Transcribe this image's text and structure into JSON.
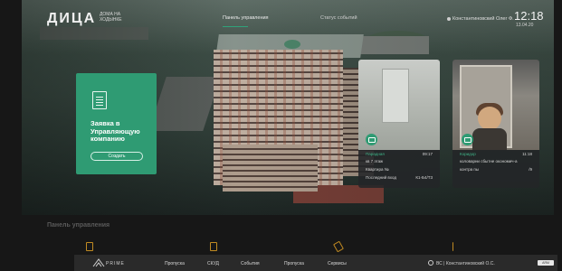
{
  "header": {
    "logo_text": "ДИЦА",
    "logo_subtitle": "ДОМА НА ХОДЫНКЕ",
    "nav": [
      {
        "label": "Панель управления",
        "active": true
      },
      {
        "label": "Статус событий",
        "active": false
      }
    ],
    "user_label": "Константиновский Олег Ф.",
    "time": "12:18",
    "date": "13.04.20"
  },
  "request_card": {
    "title": "Заявка в Управляющую компанию",
    "button_label": "Создать",
    "icon": "document-icon"
  },
  "cameras": [
    {
      "icon": "camera-icon",
      "rows": [
        {
          "left": "Парадная",
          "right": "09:17"
        },
        {
          "left": "кв 7 этаж",
          "right": ""
        },
        {
          "left": "Квартира №",
          "right": ""
        },
        {
          "left": "Последний вход",
          "right": "К1-Б4/Т3"
        }
      ]
    },
    {
      "icon": "camera-icon",
      "rows": [
        {
          "left": "Коридор",
          "right": "11:18"
        },
        {
          "left": "коловарни сбытне окономич-а",
          "right": ""
        },
        {
          "left": "",
          "right": ""
        },
        {
          "left": "контра пы",
          "right": "/9"
        }
      ]
    }
  ],
  "dashboard": {
    "title": "Панель управления"
  },
  "bottom_nav": {
    "brand": "PRIME",
    "links": [
      "Пропуска",
      "СКУД",
      "События",
      "Пропуска",
      "Сервисы"
    ],
    "user": "ВС | Константиновский О.С.",
    "badge": "ARM"
  },
  "colors": {
    "accent": "#2f9b73",
    "bg": "#171717",
    "nav_bar": "#2a2a2a",
    "tile_icon": "#c08a22"
  }
}
